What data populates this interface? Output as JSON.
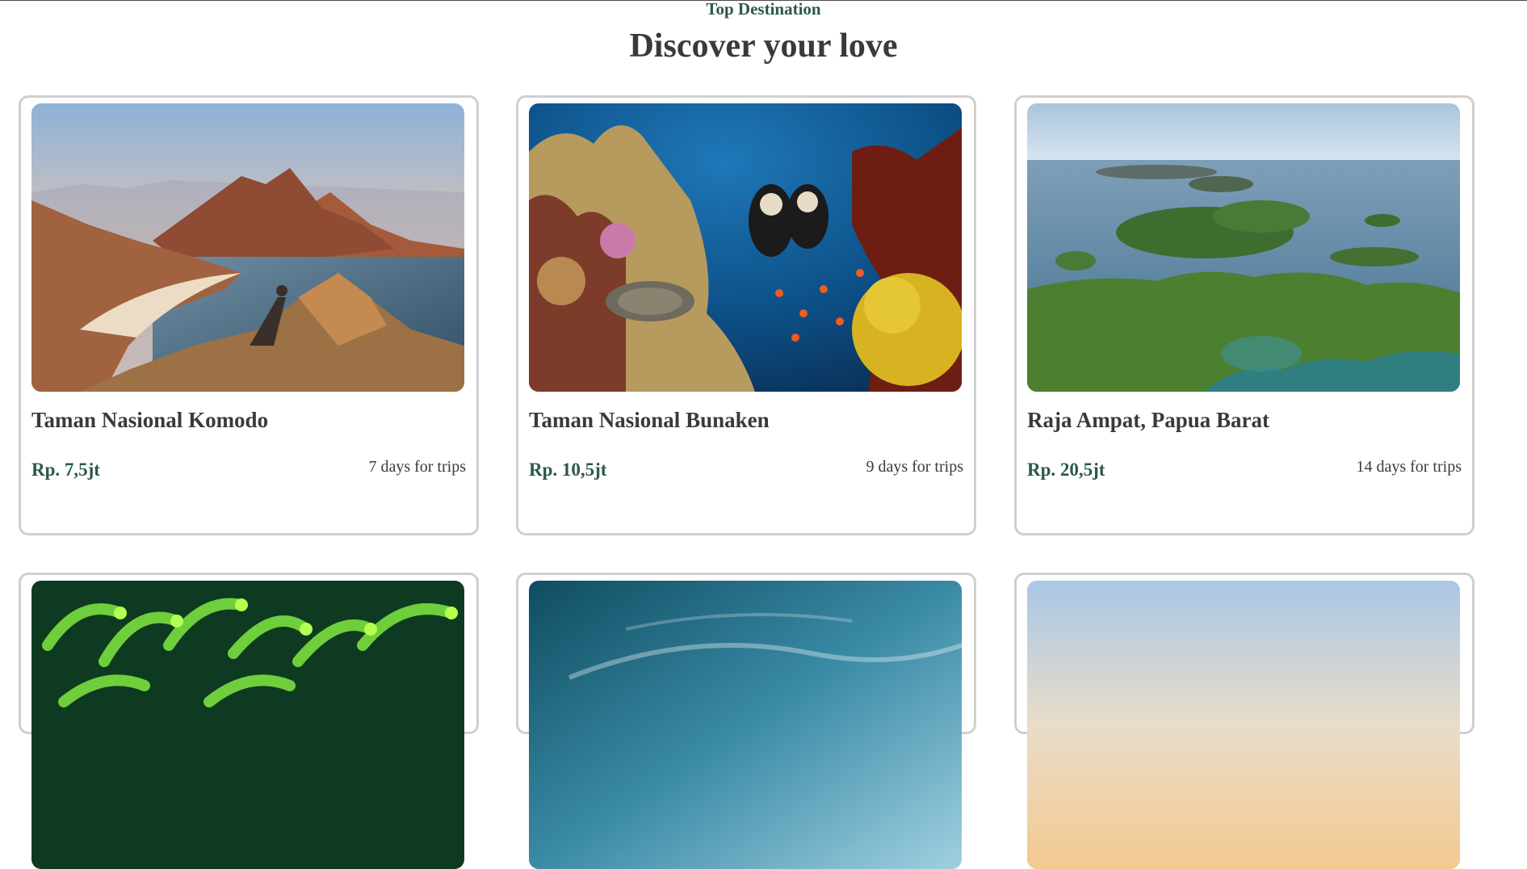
{
  "header": {
    "eyebrow": "Top Destination",
    "title": "Discover your love"
  },
  "colors": {
    "accent": "#2b5a44",
    "text": "#3a3a3a",
    "card_border": "#cfcfcf"
  },
  "destinations": [
    {
      "name": "Taman Nasional Komodo",
      "price": "Rp. 7,5jt",
      "duration": "7 days for trips",
      "photo": "komodo-hill-bay-photo"
    },
    {
      "name": "Taman Nasional Bunaken",
      "price": "Rp. 10,5jt",
      "duration": "9 days for trips",
      "photo": "coral-reef-divers-photo"
    },
    {
      "name": "Raja Ampat, Papua Barat",
      "price": "Rp. 20,5jt",
      "duration": "14 days for trips",
      "photo": "karst-islands-aerial-photo"
    }
  ],
  "more_cards": [
    {
      "photo": "green-anemone-photo"
    },
    {
      "photo": "ocean-sky-photo"
    },
    {
      "photo": "sunset-sky-photo"
    }
  ]
}
